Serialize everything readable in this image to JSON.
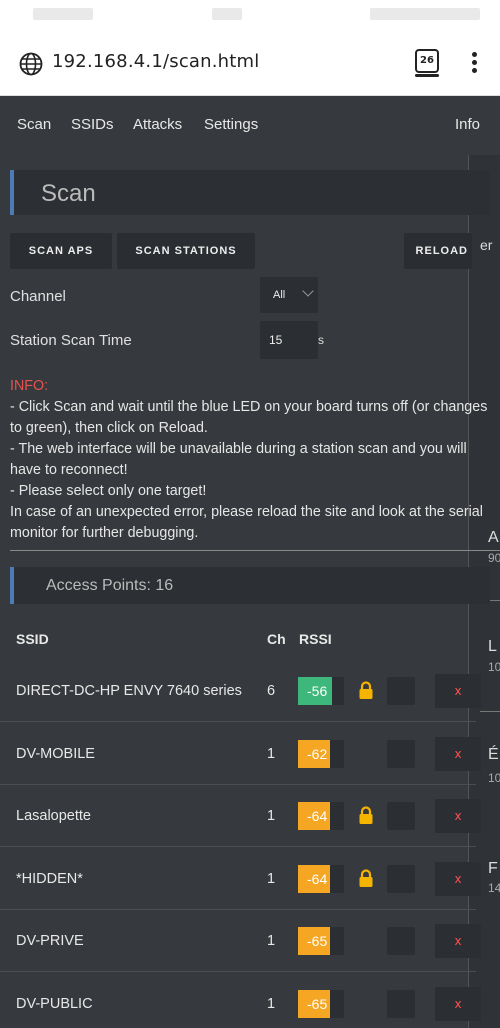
{
  "browser": {
    "url": "192.168.4.1/scan.html",
    "tab_count": "26"
  },
  "nav": {
    "scan": "Scan",
    "ssids": "SSIDs",
    "attacks": "Attacks",
    "settings": "Settings",
    "info": "Info"
  },
  "page_title": "Scan",
  "buttons": {
    "scan_aps": "SCAN APS",
    "scan_stations": "SCAN STATIONS",
    "reload": "RELOAD"
  },
  "channel": {
    "label": "Channel",
    "value": "All"
  },
  "station_scan_time": {
    "label": "Station Scan Time",
    "value": "15",
    "unit": "s"
  },
  "info": {
    "title": "INFO:",
    "lines": [
      "- Click Scan and wait until the blue LED on your board turns off (or changes to green), then click on Reload.",
      "- The web interface will be unavailable during a station scan and you will have to reconnect!",
      "- Please select only one target!",
      "In case of an unexpected error, please reload the site and look at the serial monitor for further debugging."
    ]
  },
  "access_points": {
    "header": "Access Points: 16",
    "columns": {
      "ssid": "SSID",
      "ch": "Ch",
      "rssi": "RSSI"
    },
    "rows": [
      {
        "ssid": "DIRECT-DC-HP ENVY 7640 series",
        "ch": "6",
        "rssi": "-56",
        "locked": true,
        "color": "#3db77b"
      },
      {
        "ssid": "DV-MOBILE",
        "ch": "1",
        "rssi": "-62",
        "locked": false,
        "color": "#f5a623"
      },
      {
        "ssid": "Lasalopette",
        "ch": "1",
        "rssi": "-64",
        "locked": true,
        "color": "#f5a623"
      },
      {
        "ssid": "*HIDDEN*",
        "ch": "1",
        "rssi": "-64",
        "locked": true,
        "color": "#f5a623"
      },
      {
        "ssid": "DV-PRIVE",
        "ch": "1",
        "rssi": "-65",
        "locked": false,
        "color": "#f5a623"
      },
      {
        "ssid": "DV-PUBLIC",
        "ch": "1",
        "rssi": "-65",
        "locked": false,
        "color": "#f5a623"
      }
    ],
    "delete_label": "x"
  },
  "edge_fragments": [
    "er",
    "A",
    "90",
    "L",
    "10",
    "É",
    "10",
    "F",
    "14"
  ]
}
